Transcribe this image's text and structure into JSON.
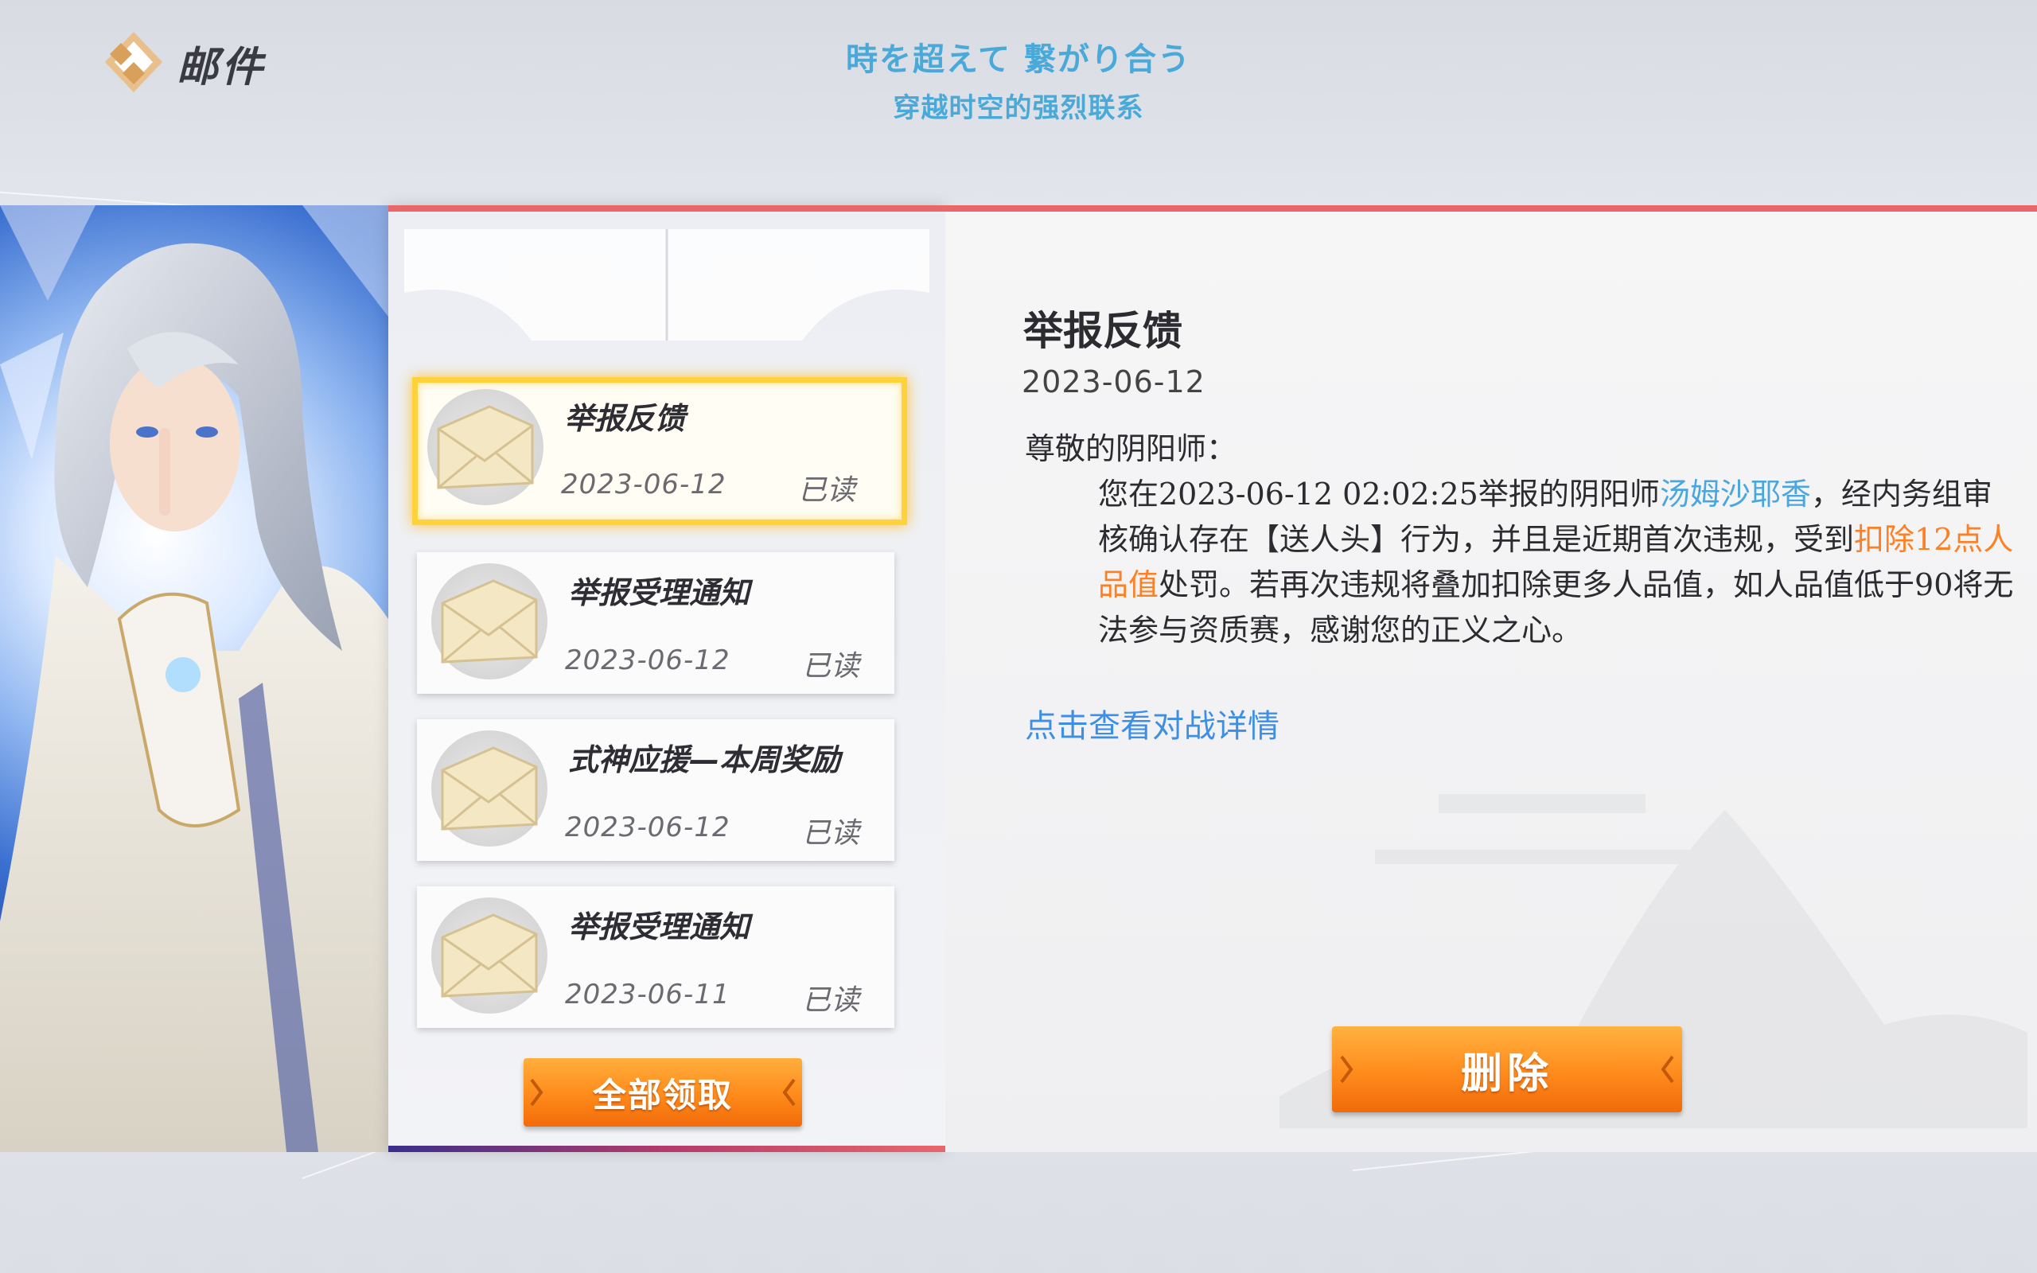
{
  "header": {
    "title": "邮件",
    "subtitle_jp": "時を超えて 繋がり合う",
    "subtitle_cn": "穿越时空的强烈联系"
  },
  "mail_list": {
    "items": [
      {
        "title": "举报反馈",
        "date": "2023-06-12",
        "status": "已读",
        "selected": true
      },
      {
        "title": "举报受理通知",
        "date": "2023-06-12",
        "status": "已读",
        "selected": false
      },
      {
        "title": "式神应援—本周奖励",
        "date": "2023-06-12",
        "status": "已读",
        "selected": false
      },
      {
        "title": "举报受理通知",
        "date": "2023-06-11",
        "status": "已读",
        "selected": false
      }
    ],
    "claim_all_label": "全部领取"
  },
  "detail": {
    "title": "举报反馈",
    "date": "2023-06-12",
    "greeting": "尊敬的阴阳师：",
    "body_1": "您在2023-06-12 02:02:25举报的阴阳师",
    "reported_player": "汤姆沙耶香",
    "body_2": "，经内务组审核确认存在【送人头】行为，并且是近期首次违规，受到",
    "penalty": "扣除12点人品值",
    "body_3": "处罚。若再次违规将叠加扣除更多人品值，如人品值低于90将无法参与资质赛，感谢您的正义之心。",
    "link_label": "点击查看对战详情",
    "delete_label": "删除"
  },
  "colors": {
    "accent_red": "#e9676b",
    "button_orange": "#ff8a1a",
    "highlight_blue": "#4aa6df",
    "highlight_orange": "#ff7f24",
    "selected_border": "#ffd23c"
  }
}
